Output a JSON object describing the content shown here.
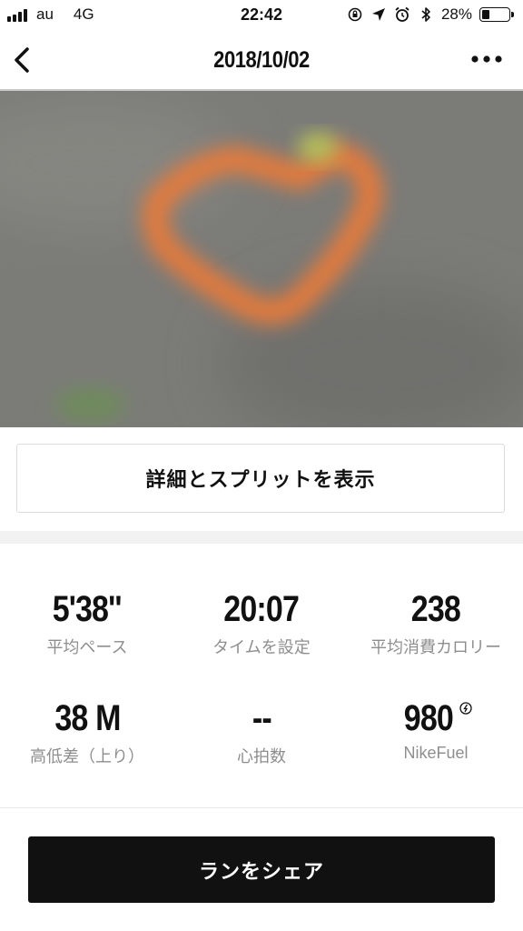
{
  "status_bar": {
    "carrier": "au",
    "network": "4G",
    "time": "22:42",
    "battery_percent": "28%",
    "battery_level": 0.28,
    "icons": [
      "orientation-lock-icon",
      "location-arrow-icon",
      "alarm-icon",
      "bluetooth-icon",
      "battery-icon"
    ]
  },
  "nav": {
    "title": "2018/10/02",
    "back_icon": "chevron-left-icon",
    "more_icon": "more-dots-icon"
  },
  "map": {
    "route_color": "#e67a3a",
    "background_color": "#7b7b78"
  },
  "details_button": {
    "label": "詳細とスプリットを表示"
  },
  "stats": [
    {
      "value": "5'38''",
      "label": "平均ペース"
    },
    {
      "value": "20:07",
      "label": "タイムを設定"
    },
    {
      "value": "238",
      "label": "平均消費カロリー"
    },
    {
      "value": "38 M",
      "label": "高低差（上り）"
    },
    {
      "value": "--",
      "label": "心拍数"
    },
    {
      "value": "980",
      "label": "NikeFuel"
    }
  ],
  "share_button": {
    "label": "ランをシェア"
  },
  "colors": {
    "text": "#111111",
    "label": "#8e8e8e",
    "button_dark": "#111111"
  }
}
